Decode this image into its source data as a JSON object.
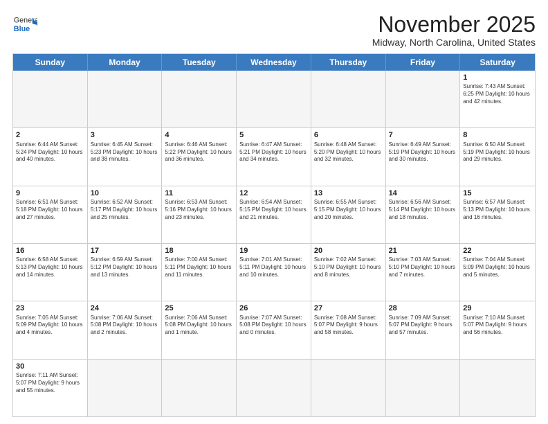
{
  "header": {
    "logo_general": "General",
    "logo_blue": "Blue",
    "month": "November 2025",
    "location": "Midway, North Carolina, United States"
  },
  "weekdays": [
    "Sunday",
    "Monday",
    "Tuesday",
    "Wednesday",
    "Thursday",
    "Friday",
    "Saturday"
  ],
  "rows": [
    [
      {
        "day": "",
        "info": ""
      },
      {
        "day": "",
        "info": ""
      },
      {
        "day": "",
        "info": ""
      },
      {
        "day": "",
        "info": ""
      },
      {
        "day": "",
        "info": ""
      },
      {
        "day": "",
        "info": ""
      },
      {
        "day": "1",
        "info": "Sunrise: 7:43 AM\nSunset: 6:25 PM\nDaylight: 10 hours and 42 minutes."
      }
    ],
    [
      {
        "day": "2",
        "info": "Sunrise: 6:44 AM\nSunset: 5:24 PM\nDaylight: 10 hours and 40 minutes."
      },
      {
        "day": "3",
        "info": "Sunrise: 6:45 AM\nSunset: 5:23 PM\nDaylight: 10 hours and 38 minutes."
      },
      {
        "day": "4",
        "info": "Sunrise: 6:46 AM\nSunset: 5:22 PM\nDaylight: 10 hours and 36 minutes."
      },
      {
        "day": "5",
        "info": "Sunrise: 6:47 AM\nSunset: 5:21 PM\nDaylight: 10 hours and 34 minutes."
      },
      {
        "day": "6",
        "info": "Sunrise: 6:48 AM\nSunset: 5:20 PM\nDaylight: 10 hours and 32 minutes."
      },
      {
        "day": "7",
        "info": "Sunrise: 6:49 AM\nSunset: 5:19 PM\nDaylight: 10 hours and 30 minutes."
      },
      {
        "day": "8",
        "info": "Sunrise: 6:50 AM\nSunset: 5:19 PM\nDaylight: 10 hours and 29 minutes."
      }
    ],
    [
      {
        "day": "9",
        "info": "Sunrise: 6:51 AM\nSunset: 5:18 PM\nDaylight: 10 hours and 27 minutes."
      },
      {
        "day": "10",
        "info": "Sunrise: 6:52 AM\nSunset: 5:17 PM\nDaylight: 10 hours and 25 minutes."
      },
      {
        "day": "11",
        "info": "Sunrise: 6:53 AM\nSunset: 5:16 PM\nDaylight: 10 hours and 23 minutes."
      },
      {
        "day": "12",
        "info": "Sunrise: 6:54 AM\nSunset: 5:15 PM\nDaylight: 10 hours and 21 minutes."
      },
      {
        "day": "13",
        "info": "Sunrise: 6:55 AM\nSunset: 5:15 PM\nDaylight: 10 hours and 20 minutes."
      },
      {
        "day": "14",
        "info": "Sunrise: 6:56 AM\nSunset: 5:14 PM\nDaylight: 10 hours and 18 minutes."
      },
      {
        "day": "15",
        "info": "Sunrise: 6:57 AM\nSunset: 5:13 PM\nDaylight: 10 hours and 16 minutes."
      }
    ],
    [
      {
        "day": "16",
        "info": "Sunrise: 6:58 AM\nSunset: 5:13 PM\nDaylight: 10 hours and 14 minutes."
      },
      {
        "day": "17",
        "info": "Sunrise: 6:59 AM\nSunset: 5:12 PM\nDaylight: 10 hours and 13 minutes."
      },
      {
        "day": "18",
        "info": "Sunrise: 7:00 AM\nSunset: 5:11 PM\nDaylight: 10 hours and 11 minutes."
      },
      {
        "day": "19",
        "info": "Sunrise: 7:01 AM\nSunset: 5:11 PM\nDaylight: 10 hours and 10 minutes."
      },
      {
        "day": "20",
        "info": "Sunrise: 7:02 AM\nSunset: 5:10 PM\nDaylight: 10 hours and 8 minutes."
      },
      {
        "day": "21",
        "info": "Sunrise: 7:03 AM\nSunset: 5:10 PM\nDaylight: 10 hours and 7 minutes."
      },
      {
        "day": "22",
        "info": "Sunrise: 7:04 AM\nSunset: 5:09 PM\nDaylight: 10 hours and 5 minutes."
      }
    ],
    [
      {
        "day": "23",
        "info": "Sunrise: 7:05 AM\nSunset: 5:09 PM\nDaylight: 10 hours and 4 minutes."
      },
      {
        "day": "24",
        "info": "Sunrise: 7:06 AM\nSunset: 5:08 PM\nDaylight: 10 hours and 2 minutes."
      },
      {
        "day": "25",
        "info": "Sunrise: 7:06 AM\nSunset: 5:08 PM\nDaylight: 10 hours and 1 minute."
      },
      {
        "day": "26",
        "info": "Sunrise: 7:07 AM\nSunset: 5:08 PM\nDaylight: 10 hours and 0 minutes."
      },
      {
        "day": "27",
        "info": "Sunrise: 7:08 AM\nSunset: 5:07 PM\nDaylight: 9 hours and 58 minutes."
      },
      {
        "day": "28",
        "info": "Sunrise: 7:09 AM\nSunset: 5:07 PM\nDaylight: 9 hours and 57 minutes."
      },
      {
        "day": "29",
        "info": "Sunrise: 7:10 AM\nSunset: 5:07 PM\nDaylight: 9 hours and 56 minutes."
      }
    ],
    [
      {
        "day": "30",
        "info": "Sunrise: 7:11 AM\nSunset: 5:07 PM\nDaylight: 9 hours and 55 minutes."
      },
      {
        "day": "",
        "info": ""
      },
      {
        "day": "",
        "info": ""
      },
      {
        "day": "",
        "info": ""
      },
      {
        "day": "",
        "info": ""
      },
      {
        "day": "",
        "info": ""
      },
      {
        "day": "",
        "info": ""
      }
    ]
  ]
}
